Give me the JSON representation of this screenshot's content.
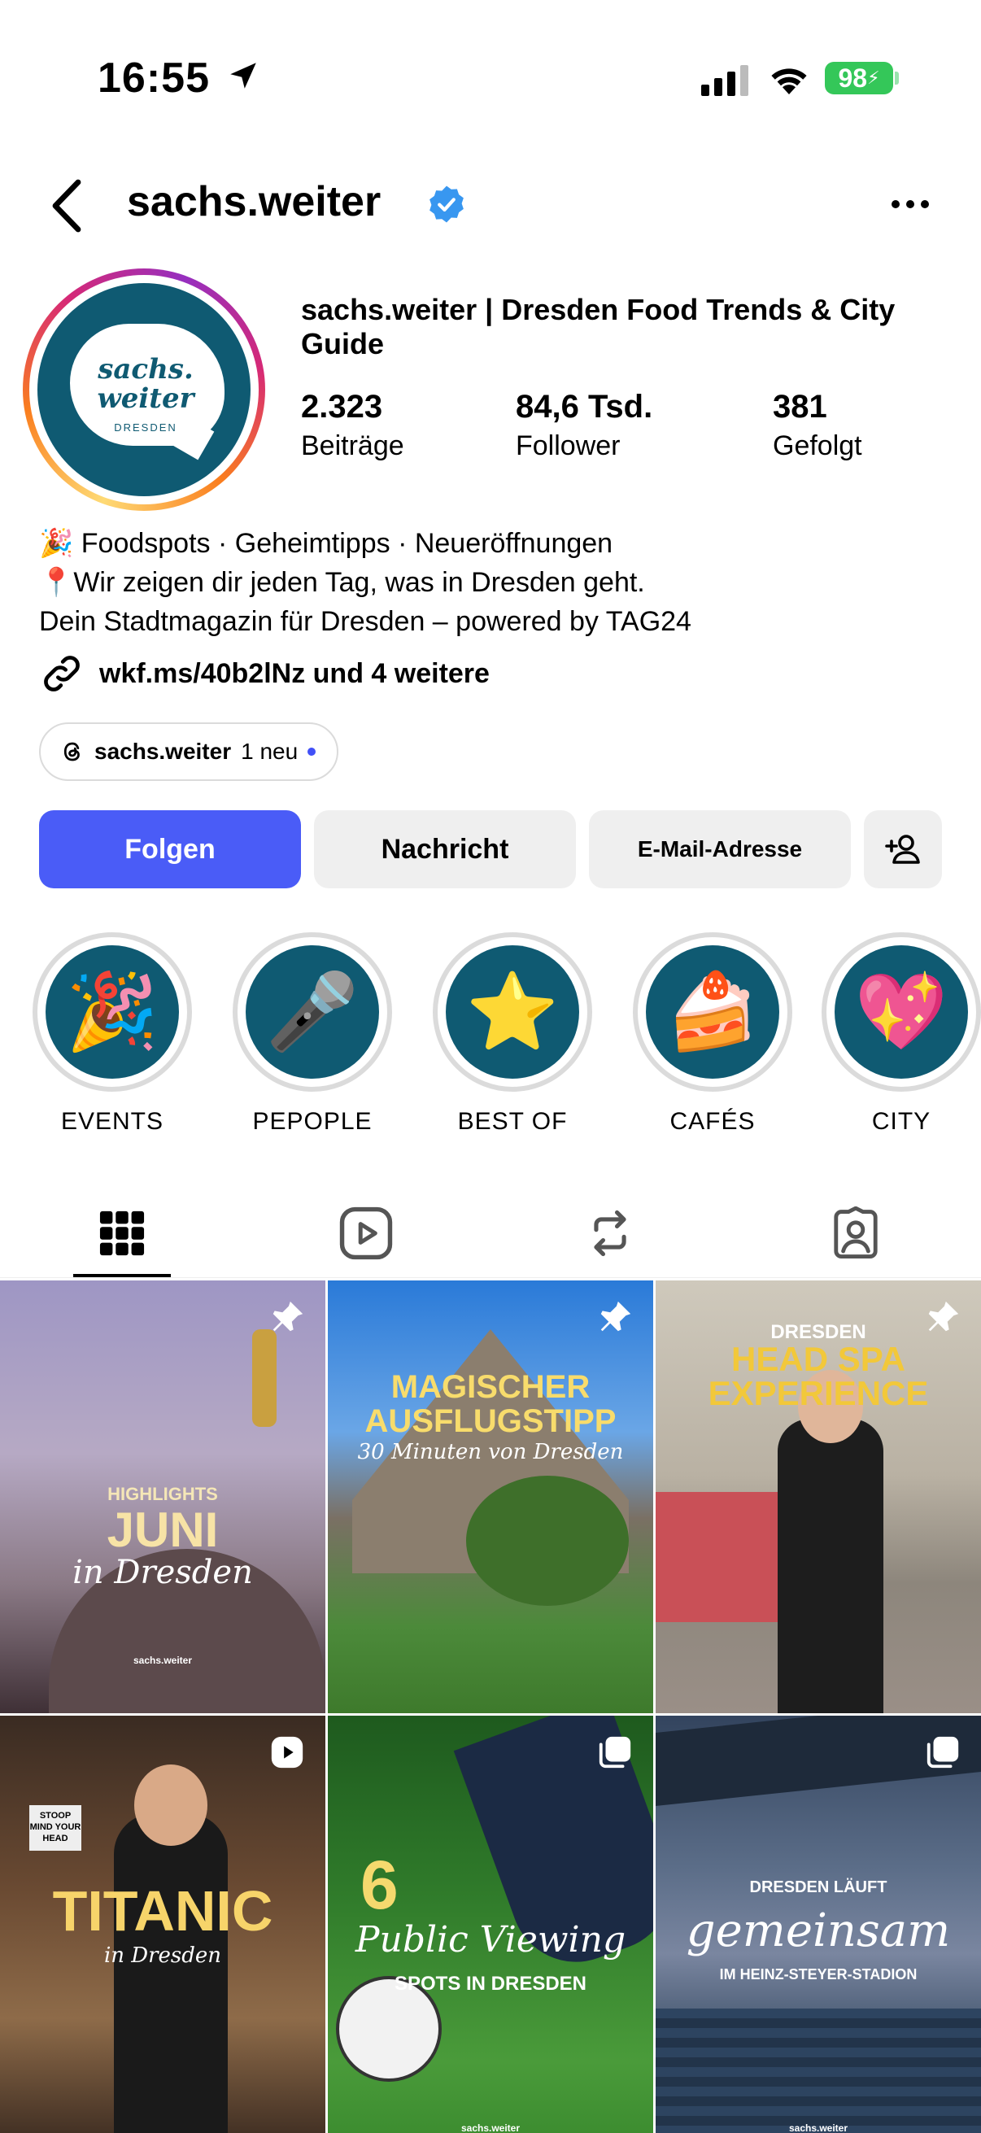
{
  "status_bar": {
    "time": "16:55",
    "battery": "98",
    "colors": {
      "battery": "#34c759"
    }
  },
  "header": {
    "username": "sachs.weiter"
  },
  "profile": {
    "avatar_text_line1": "sachs.",
    "avatar_text_line2": "weiter",
    "avatar_sub": "DRESDEN",
    "display_name": "sachs.weiter | Dresden Food Trends & City Guide",
    "stats": [
      {
        "value": "2.323",
        "label": "Beiträge"
      },
      {
        "value": "84,6 Tsd.",
        "label": "Follower"
      },
      {
        "value": "381",
        "label": "Gefolgt"
      }
    ],
    "bio": [
      "🎉 Foodspots · Geheimtipps · Neueröffnungen",
      "📍Wir zeigen dir jeden Tag, was in Dresden geht.",
      "Dein Stadtmagazin für Dresden – powered by TAG24"
    ],
    "link": "wkf.ms/40b2lNz und 4 weitere",
    "threads": {
      "name": "sachs.weiter",
      "badge": "1 neu"
    }
  },
  "actions": {
    "follow": "Folgen",
    "message": "Nachricht",
    "email": "E-Mail-Adresse"
  },
  "highlights": [
    {
      "emoji": "🎉",
      "label": "EVENTS"
    },
    {
      "emoji": "🎤",
      "label": "PEPOPLE"
    },
    {
      "emoji": "⭐",
      "label": "BEST OF"
    },
    {
      "emoji": "🍰",
      "label": "CAFÉS"
    },
    {
      "emoji": "💖",
      "label": "CITY"
    }
  ],
  "tabs": [
    "grid",
    "reels",
    "reposts",
    "tagged"
  ],
  "posts": [
    {
      "kicker": "HIGHLIGHTS",
      "title": "JUNI",
      "script": "in Dresden",
      "brand": "sachs.weiter",
      "icon": "pin"
    },
    {
      "title": "MAGISCHER AUSFLUGSTIPP",
      "script": "30 Minuten von Dresden",
      "icon": "pin"
    },
    {
      "kicker": "DRESDEN",
      "title": "HEAD SPA EXPERIENCE",
      "icon": "pin"
    },
    {
      "title": "TITANIC",
      "script": "in Dresden",
      "sign": "STOOP MIND YOUR HEAD",
      "icon": "reel"
    },
    {
      "number": "6",
      "script": "Public Viewing",
      "title": "SPOTS IN DRESDEN",
      "brand": "sachs.weiter",
      "icon": "carousel"
    },
    {
      "kicker": "DRESDEN LÄUFT",
      "script": "gemeinsam",
      "title": "IM HEINZ-STEYER-STADION",
      "brand": "sachs.weiter",
      "icon": "carousel"
    }
  ],
  "colors": {
    "accent_blue": "#4a5cf7",
    "brand_teal": "#0f5a72",
    "verified": "#3897f0"
  }
}
